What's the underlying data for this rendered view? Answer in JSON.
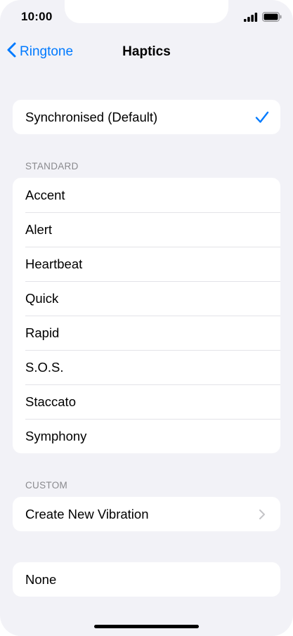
{
  "status_bar": {
    "time": "10:00",
    "signal_icon": "signal-bars-icon",
    "battery_icon": "battery-icon"
  },
  "nav": {
    "back_label": "Ringtone",
    "back_icon": "chevron-left-icon",
    "title": "Haptics"
  },
  "default_group": {
    "items": [
      {
        "label": "Synchronised (Default)",
        "selected": true
      }
    ]
  },
  "standard": {
    "header": "STANDARD",
    "items": [
      {
        "label": "Accent"
      },
      {
        "label": "Alert"
      },
      {
        "label": "Heartbeat"
      },
      {
        "label": "Quick"
      },
      {
        "label": "Rapid"
      },
      {
        "label": "S.O.S."
      },
      {
        "label": "Staccato"
      },
      {
        "label": "Symphony"
      }
    ]
  },
  "custom": {
    "header": "CUSTOM",
    "items": [
      {
        "label": "Create New Vibration",
        "disclosure": true
      }
    ]
  },
  "none_group": {
    "items": [
      {
        "label": "None"
      }
    ]
  },
  "colors": {
    "accent": "#007aff",
    "background": "#f2f2f7",
    "secondary_text": "#8a8a8e",
    "chevron": "#c4c4c7"
  }
}
